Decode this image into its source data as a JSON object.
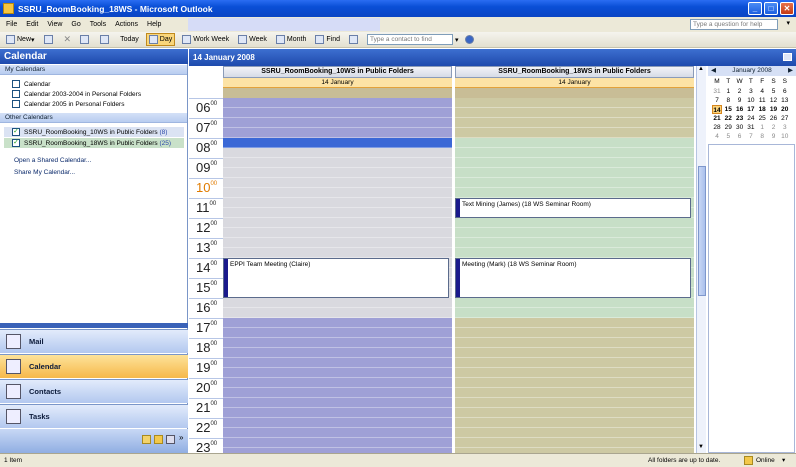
{
  "window": {
    "title": "SSRU_RoomBooking_18WS - Microsoft Outlook"
  },
  "menu": {
    "items": [
      "File",
      "Edit",
      "View",
      "Go",
      "Tools",
      "Actions",
      "Help"
    ],
    "ask_placeholder": "Type a question for help"
  },
  "toolbar": {
    "new_label": "New",
    "today_label": "Today",
    "day_label": "Day",
    "workweek_label": "Work Week",
    "week_label": "Week",
    "month_label": "Month",
    "find_label": "Find",
    "contact_placeholder": "Type a contact to find"
  },
  "nav": {
    "title": "Calendar",
    "my_calendars_header": "My Calendars",
    "my_calendars": [
      "Calendar",
      "Calendar 2003-2004 in Personal Folders",
      "Calendar 2005 in Personal Folders"
    ],
    "other_calendars_header": "Other Calendars",
    "other_calendars": [
      {
        "label": "SSRU_RoomBooking_10WS in Public Folders",
        "count": "(8)",
        "checked": true
      },
      {
        "label": "SSRU_RoomBooking_18WS in Public Folders",
        "count": "(25)",
        "checked": true
      }
    ],
    "links": [
      "Open a Shared Calendar...",
      "Share My Calendar..."
    ],
    "buttons": [
      "Mail",
      "Calendar",
      "Contacts",
      "Tasks"
    ]
  },
  "calendar": {
    "header_date": "14 January 2008",
    "columns": [
      {
        "title": "SSRU_RoomBooking_10WS in Public Folders",
        "date": "14 January"
      },
      {
        "title": "SSRU_RoomBooking_18WS in Public Folders",
        "date": "14 January"
      }
    ],
    "hours": [
      "06",
      "07",
      "08",
      "09",
      "10",
      "11",
      "12",
      "13",
      "14",
      "15",
      "16",
      "17",
      "18",
      "19",
      "20",
      "21",
      "22",
      "23"
    ],
    "minutes_label": "00",
    "appointments": [
      {
        "column": 0,
        "text": "EPPI Team Meeting (Claire)",
        "start": "14:00",
        "end": "16:00"
      },
      {
        "column": 1,
        "text": "Text Mining (James) (18 WS Seminar Room)",
        "start": "11:00",
        "end": "12:00"
      },
      {
        "column": 1,
        "text": "Meeting (Mark) (18 WS Seminar Room)",
        "start": "14:00",
        "end": "16:00"
      }
    ]
  },
  "minical": {
    "month_label": "January 2008",
    "weekdays": [
      "M",
      "T",
      "W",
      "T",
      "F",
      "S",
      "S"
    ],
    "weeks": [
      [
        "31",
        "1",
        "2",
        "3",
        "4",
        "5",
        "6"
      ],
      [
        "7",
        "8",
        "9",
        "10",
        "11",
        "12",
        "13"
      ],
      [
        "14",
        "15",
        "16",
        "17",
        "18",
        "19",
        "20"
      ],
      [
        "21",
        "22",
        "23",
        "24",
        "25",
        "26",
        "27"
      ],
      [
        "28",
        "29",
        "30",
        "31",
        "1",
        "2",
        "3"
      ],
      [
        "4",
        "5",
        "6",
        "7",
        "8",
        "9",
        "10"
      ]
    ],
    "today": "14"
  },
  "status": {
    "left": "1 Item",
    "right": "All folders are up to date.",
    "online": "Online"
  },
  "colors": {
    "title_blue": "#0a4fd6",
    "work_hours_green": "#c7dfc7",
    "off_hours_purple": "#9fa0d6",
    "col2_off_hours": "#cdc9a3",
    "today_highlight": "#fde3a5"
  }
}
